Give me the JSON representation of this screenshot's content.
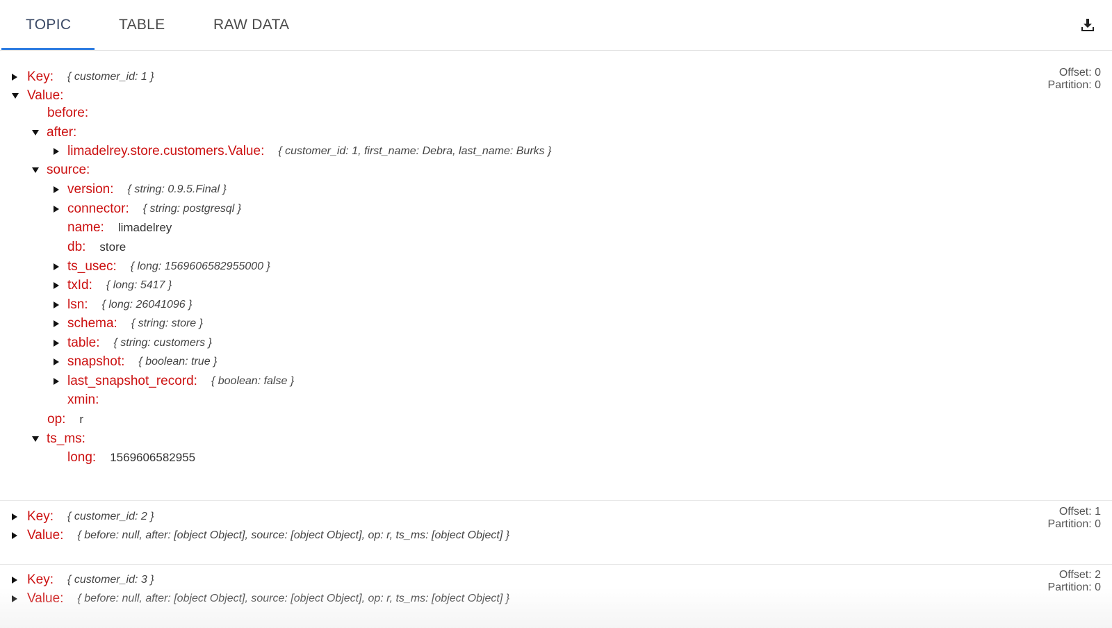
{
  "tabs": [
    {
      "label": "TOPIC",
      "active": true
    },
    {
      "label": "TABLE",
      "active": false
    },
    {
      "label": "RAW DATA",
      "active": false
    }
  ],
  "toolbar": {
    "download_icon": "download-icon"
  },
  "colors": {
    "key": "#cc1111",
    "accent": "#2f7de1",
    "text": "#333333"
  },
  "records": [
    {
      "offset": "Offset: 0",
      "partition": "Partition: 0",
      "key_label": "Key:",
      "key_summary": "{ customer_id: 1 }",
      "value_label": "Value:",
      "fields": {
        "before": "before:",
        "after": "after:",
        "after_child": "limadelrey.store.customers.Value:",
        "after_child_summary": "{ customer_id: 1, first_name: Debra, last_name: Burks }",
        "source": "source:",
        "version": "version:",
        "version_summary": "{ string: 0.9.5.Final }",
        "connector": "connector:",
        "connector_summary": "{ string: postgresql }",
        "name": "name:",
        "name_value": "limadelrey",
        "db": "db:",
        "db_value": "store",
        "ts_usec": "ts_usec:",
        "ts_usec_summary": "{ long: 1569606582955000 }",
        "txId": "txId:",
        "txId_summary": "{ long: 5417 }",
        "lsn": "lsn:",
        "lsn_summary": "{ long: 26041096 }",
        "schema": "schema:",
        "schema_summary": "{ string: store }",
        "table": "table:",
        "table_summary": "{ string: customers }",
        "snapshot": "snapshot:",
        "snapshot_summary": "{ boolean: true }",
        "last_snapshot_record": "last_snapshot_record:",
        "last_snapshot_record_summary": "{ boolean: false }",
        "xmin": "xmin:",
        "op": "op:",
        "op_value": "r",
        "ts_ms": "ts_ms:",
        "long": "long:",
        "long_value": "1569606582955"
      }
    },
    {
      "offset": "Offset: 1",
      "partition": "Partition: 0",
      "key_label": "Key:",
      "key_summary": "{ customer_id: 2 }",
      "value_label": "Value:",
      "value_summary": "{ before: null, after: [object Object], source: [object Object], op: r, ts_ms: [object Object] }"
    },
    {
      "offset": "Offset: 2",
      "partition": "Partition: 0",
      "key_label": "Key:",
      "key_summary": "{ customer_id: 3 }",
      "value_label": "Value:",
      "value_summary": "{ before: null, after: [object Object], source: [object Object], op: r, ts_ms: [object Object] }"
    }
  ]
}
